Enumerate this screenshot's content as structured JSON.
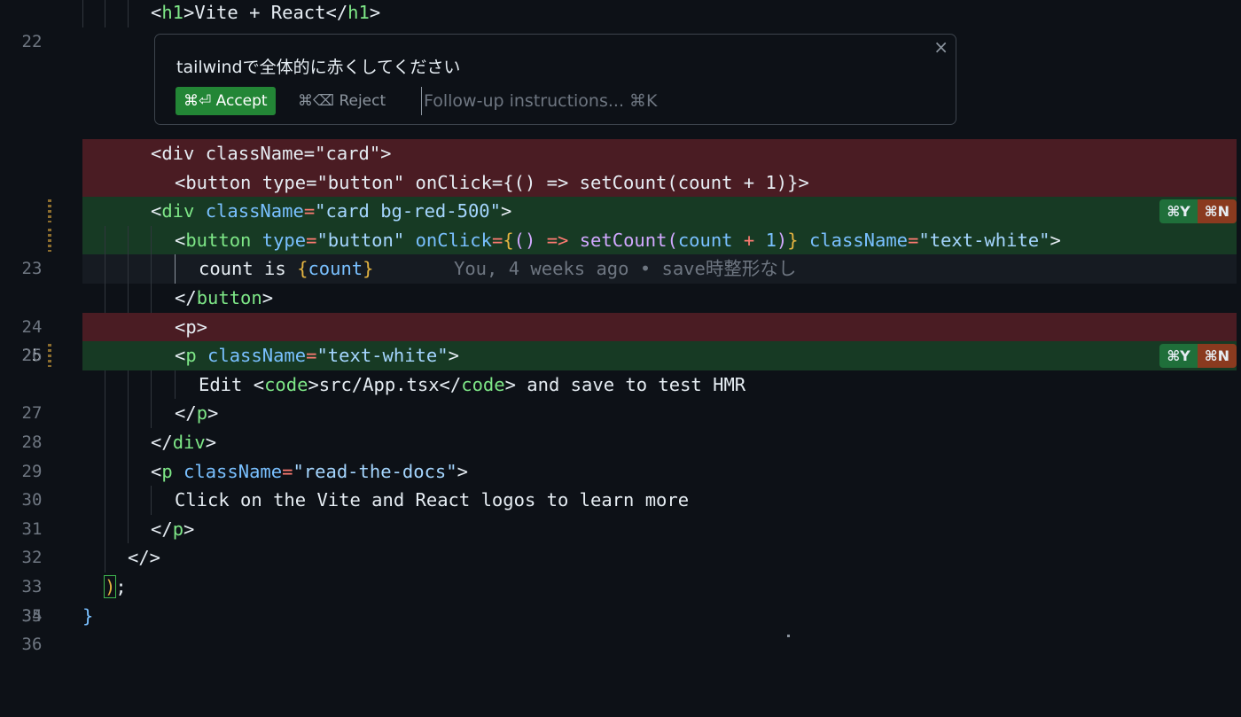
{
  "lines": {
    "l22": {
      "num": "22",
      "t": [
        "<",
        "h1",
        ">Vite + React</",
        "h1",
        ">"
      ]
    },
    "d1": {
      "t": "<div className=\"card\">"
    },
    "d2": {
      "t": "<button type=\"button\" onClick={() => setCount(count + 1)}>"
    },
    "l23": {
      "num": "23",
      "t": [
        "<",
        "div",
        " ",
        "className",
        "=",
        "\"card bg-red-500\"",
        ">"
      ]
    },
    "l24": {
      "num": "24",
      "t": [
        "<",
        "button",
        " ",
        "type",
        "=",
        "\"button\"",
        " ",
        "onClick",
        "=",
        "{",
        "()",
        " ",
        "=>",
        " ",
        "setCount",
        "(",
        "count",
        " ",
        "+",
        " ",
        "1",
        ")",
        "}",
        " ",
        "className",
        "=",
        "\"text-white\"",
        ">"
      ]
    },
    "l25": {
      "num": "25",
      "t": [
        "count is ",
        "{",
        "count",
        "}"
      ],
      "blame": "You, 4 weeks ago • save時整形なし"
    },
    "l26": {
      "num": "26",
      "t": [
        "</",
        "button",
        ">"
      ]
    },
    "d3": {
      "t": "<p>"
    },
    "l27": {
      "num": "27",
      "t": [
        "<",
        "p",
        " ",
        "className",
        "=",
        "\"text-white\"",
        ">"
      ]
    },
    "l28": {
      "num": "28",
      "t": [
        "Edit <",
        "code",
        ">src/App.tsx</",
        "code",
        "> and save to test HMR"
      ]
    },
    "l29": {
      "num": "29",
      "t": [
        "</",
        "p",
        ">"
      ]
    },
    "l30": {
      "num": "30",
      "t": [
        "</",
        "div",
        ">"
      ]
    },
    "l31": {
      "num": "31",
      "t": [
        "<",
        "p",
        " ",
        "className",
        "=",
        "\"read-the-docs\"",
        ">"
      ]
    },
    "l32": {
      "num": "32",
      "t": "Click on the Vite and React logos to learn more"
    },
    "l33": {
      "num": "33",
      "t": [
        "</",
        "p",
        ">"
      ]
    },
    "l34": {
      "num": "34",
      "t": "</>"
    },
    "l35": {
      "num": "35",
      "t": [
        ")",
        ";"
      ]
    },
    "l36": {
      "num": "36",
      "t": "}"
    }
  },
  "keybinds": {
    "accept_y": "⌘Y",
    "reject_n": "⌘N"
  },
  "widget": {
    "instruction": "tailwindで全体的に赤くしてください",
    "accept_label": "⌘⏎ Accept",
    "reject_label": "⌘⌫ Reject",
    "followup_placeholder": "Follow-up instructions... ⌘K",
    "close_glyph": "×"
  },
  "colors": {
    "added": "#173a24",
    "deleted": "#4a1c23",
    "accept": "#238636"
  }
}
